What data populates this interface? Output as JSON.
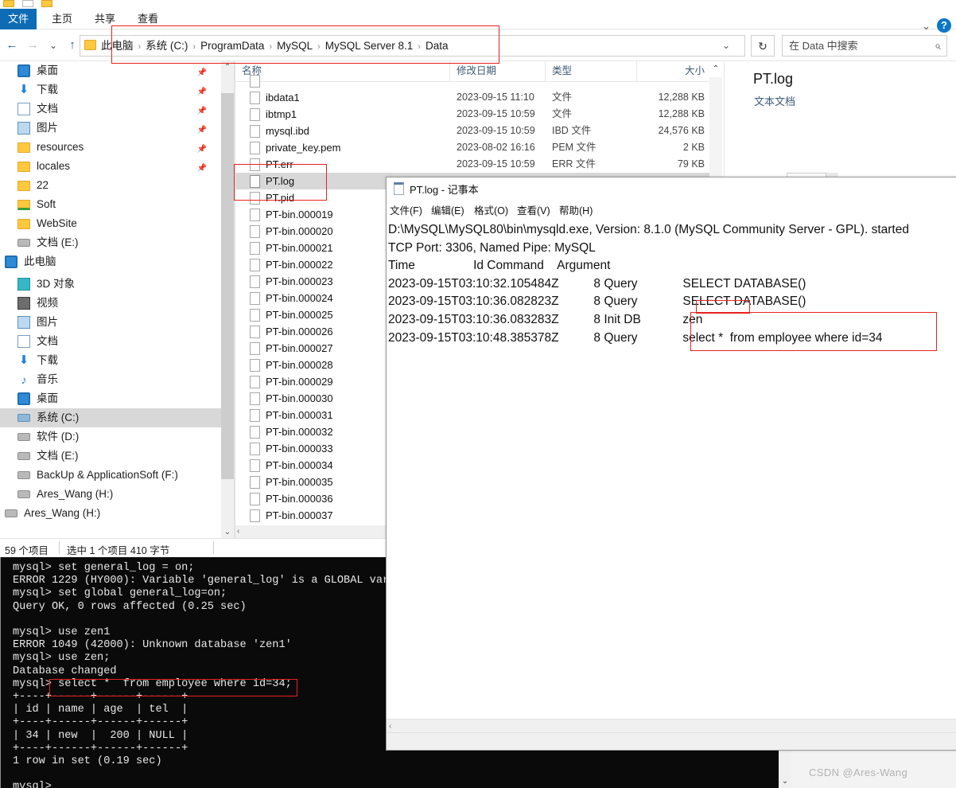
{
  "explorer": {
    "ribbon": {
      "tabs": [
        {
          "label": "文件",
          "name": "tab-file"
        },
        {
          "label": "主页",
          "name": "tab-home"
        },
        {
          "label": "共享",
          "name": "tab-share"
        },
        {
          "label": "查看",
          "name": "tab-view"
        }
      ],
      "help_label": "?",
      "chevron": "⌄"
    },
    "nav": {
      "back": "←",
      "forward": "→",
      "recent": "⌄",
      "up": "↑"
    },
    "address": {
      "crumbs": [
        "此电脑",
        "系统 (C:)",
        "ProgramData",
        "MySQL",
        "MySQL Server 8.1",
        "Data"
      ],
      "separator": "›",
      "dropdown": "⌄",
      "refresh": "↻"
    },
    "search": {
      "placeholder": "在 Data 中搜索",
      "icon": "⌕"
    },
    "sidebar": [
      {
        "label": "桌面",
        "icon": "desktop-icon",
        "indent": 1,
        "pinned": true
      },
      {
        "label": "下载",
        "icon": "download-icon",
        "indent": 1,
        "pinned": true
      },
      {
        "label": "文档",
        "icon": "document-icon",
        "indent": 1,
        "pinned": true
      },
      {
        "label": "图片",
        "icon": "pictures-icon",
        "indent": 1,
        "pinned": true
      },
      {
        "label": "resources",
        "icon": "folder-icon",
        "indent": 1,
        "pinned": true
      },
      {
        "label": "locales",
        "icon": "folder-icon",
        "indent": 1,
        "pinned": true
      },
      {
        "label": "22",
        "icon": "folder-icon",
        "indent": 1,
        "pinned": false
      },
      {
        "label": "Soft",
        "icon": "shared-folder-icon",
        "indent": 1,
        "pinned": false
      },
      {
        "label": "WebSite",
        "icon": "folder-icon",
        "indent": 1,
        "pinned": false
      },
      {
        "label": "文档 (E:)",
        "icon": "drive-icon",
        "indent": 1,
        "pinned": false
      },
      {
        "label": "此电脑",
        "icon": "this-pc-icon",
        "indent": 0,
        "pinned": false
      },
      {
        "label": "3D 对象",
        "icon": "3d-objects-icon",
        "indent": 1,
        "pinned": false
      },
      {
        "label": "视频",
        "icon": "videos-icon",
        "indent": 1,
        "pinned": false
      },
      {
        "label": "图片",
        "icon": "pictures-icon",
        "indent": 1,
        "pinned": false
      },
      {
        "label": "文档",
        "icon": "document-icon",
        "indent": 1,
        "pinned": false
      },
      {
        "label": "下载",
        "icon": "download-icon",
        "indent": 1,
        "pinned": false
      },
      {
        "label": "音乐",
        "icon": "music-icon",
        "indent": 1,
        "pinned": false
      },
      {
        "label": "桌面",
        "icon": "desktop-icon",
        "indent": 1,
        "pinned": false
      },
      {
        "label": "系统 (C:)",
        "icon": "system-drive-icon",
        "indent": 1,
        "pinned": false,
        "selected": true
      },
      {
        "label": "软件 (D:)",
        "icon": "drive-icon",
        "indent": 1,
        "pinned": false
      },
      {
        "label": "文档 (E:)",
        "icon": "drive-icon",
        "indent": 1,
        "pinned": false
      },
      {
        "label": "BackUp & ApplicationSoft (F:)",
        "icon": "drive-icon",
        "indent": 1,
        "pinned": false
      },
      {
        "label": "Ares_Wang (H:)",
        "icon": "drive-icon",
        "indent": 1,
        "pinned": false
      },
      {
        "label": "Ares_Wang (H:)",
        "icon": "drive-icon",
        "indent": 0,
        "pinned": false
      }
    ],
    "columns": [
      "名称",
      "修改日期",
      "类型",
      "大小"
    ],
    "files": [
      {
        "name": "",
        "date": "",
        "type": "",
        "size": "",
        "partial": true
      },
      {
        "name": "ibdata1",
        "date": "2023-09-15 11:10",
        "type": "文件",
        "size": "12,288 KB"
      },
      {
        "name": "ibtmp1",
        "date": "2023-09-15 10:59",
        "type": "文件",
        "size": "12,288 KB"
      },
      {
        "name": "mysql.ibd",
        "date": "2023-09-15 10:59",
        "type": "IBD 文件",
        "size": "24,576 KB"
      },
      {
        "name": "private_key.pem",
        "date": "2023-08-02 16:16",
        "type": "PEM 文件",
        "size": "2 KB"
      },
      {
        "name": "PT.err",
        "date": "2023-09-15 10:59",
        "type": "ERR 文件",
        "size": "79 KB"
      },
      {
        "name": "PT.log",
        "date": "",
        "type": "",
        "size": "",
        "selected": true
      },
      {
        "name": "PT.pid",
        "date": "",
        "type": "",
        "size": ""
      },
      {
        "name": "PT-bin.000019",
        "date": "",
        "type": "",
        "size": ""
      },
      {
        "name": "PT-bin.000020",
        "date": "",
        "type": "",
        "size": ""
      },
      {
        "name": "PT-bin.000021",
        "date": "",
        "type": "",
        "size": ""
      },
      {
        "name": "PT-bin.000022",
        "date": "",
        "type": "",
        "size": ""
      },
      {
        "name": "PT-bin.000023",
        "date": "",
        "type": "",
        "size": ""
      },
      {
        "name": "PT-bin.000024",
        "date": "",
        "type": "",
        "size": ""
      },
      {
        "name": "PT-bin.000025",
        "date": "",
        "type": "",
        "size": ""
      },
      {
        "name": "PT-bin.000026",
        "date": "",
        "type": "",
        "size": ""
      },
      {
        "name": "PT-bin.000027",
        "date": "",
        "type": "",
        "size": ""
      },
      {
        "name": "PT-bin.000028",
        "date": "",
        "type": "",
        "size": ""
      },
      {
        "name": "PT-bin.000029",
        "date": "",
        "type": "",
        "size": ""
      },
      {
        "name": "PT-bin.000030",
        "date": "",
        "type": "",
        "size": ""
      },
      {
        "name": "PT-bin.000031",
        "date": "",
        "type": "",
        "size": ""
      },
      {
        "name": "PT-bin.000032",
        "date": "",
        "type": "",
        "size": ""
      },
      {
        "name": "PT-bin.000033",
        "date": "",
        "type": "",
        "size": ""
      },
      {
        "name": "PT-bin.000034",
        "date": "",
        "type": "",
        "size": ""
      },
      {
        "name": "PT-bin.000035",
        "date": "",
        "type": "",
        "size": ""
      },
      {
        "name": "PT-bin.000036",
        "date": "",
        "type": "",
        "size": ""
      },
      {
        "name": "PT-bin.000037",
        "date": "",
        "type": "",
        "size": ""
      }
    ],
    "preview": {
      "title": "PT.log",
      "subtitle": "文本文档"
    },
    "status": {
      "count": "59 个项目",
      "selection": "选中 1 个项目  410 字节"
    }
  },
  "notepad": {
    "title": "PT.log - 记事本",
    "menu": [
      "文件(F)",
      "编辑(E)",
      "格式(O)",
      "查看(V)",
      "帮助(H)"
    ],
    "content": "D:\\MySQL\\MySQL80\\bin\\mysqld.exe, Version: 8.1.0 (MySQL Community Server - GPL). started\nTCP Port: 3306, Named Pipe: MySQL\nTime                 Id Command    Argument\n2023-09-15T03:10:32.105484Z\t    8 Query\t      SELECT DATABASE()\n2023-09-15T03:10:36.082823Z\t    8 Query\t      SELECT DATABASE()\n2023-09-15T03:10:36.083283Z\t    8 Init DB\t      zen\n2023-09-15T03:10:48.385378Z\t    8 Query\t      select *  from employee where id=34",
    "hscroll_left": "‹"
  },
  "console": {
    "content": "mysql> set general_log = on;\nERROR 1229 (HY000): Variable 'general_log' is a GLOBAL vari\nmysql> set global general_log=on;\nQuery OK, 0 rows affected (0.25 sec)\n\nmysql> use zen1\nERROR 1049 (42000): Unknown database 'zen1'\nmysql> use zen;\nDatabase changed\nmysql> select *  from employee where id=34;\n+----+------+------+------+\n| id | name | age  | tel  |\n+----+------+------+------+\n| 34 | new  |  200 | NULL |\n+----+------+------+------+\n1 row in set (0.19 sec)\n\nmysql>",
    "scroll_down": "⌄"
  },
  "watermark": "CSDN @Ares-Wang",
  "colors": {
    "accent": "#0d6cb4",
    "annotation": "#e8221f",
    "selection": "#d8d8d8",
    "console_bg": "#0a0a0a"
  }
}
